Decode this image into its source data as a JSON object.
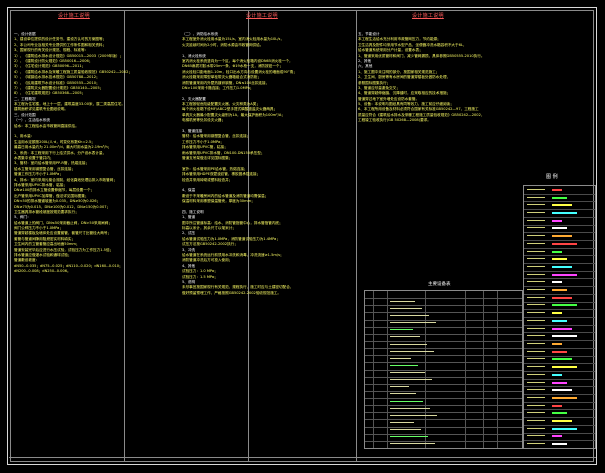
{
  "sheet": {
    "col1_title": "设计施工说明",
    "col2_title": "设计施工说明",
    "col3_title": "设计施工说明",
    "legend_title": "图 例",
    "table_title": "主要设备表"
  },
  "col1": [
    {
      "t": "一、设计依据",
      "s": "h"
    },
    {
      "t": "1、建设单位提供的设计任务书，建设方认可的方案图等；",
      "s": "y"
    },
    {
      "t": "2、本公司专业及相关专业提供的工作条件图和相关资料；",
      "s": "y"
    },
    {
      "t": "3、国家现行的有关设计规范、规程、标准等：",
      "s": "y"
    },
    {
      "t": "  1）、《建筑给水排水设计规范》GB50015—2003（2009年版）；",
      "s": "y"
    },
    {
      "t": "  2）、《建筑设计防火规范》GB50016—2006；",
      "s": "y"
    },
    {
      "t": "  3）、《住宅设计规范》GB50096—2011；",
      "s": "y"
    },
    {
      "t": "  4）、《建筑给水排水及采暖工程施工质量验收规范》GB50242—2002；",
      "s": "y"
    },
    {
      "t": "  5）、《城镇给水排水技术规范》GB50788—2012；",
      "s": "y"
    },
    {
      "t": "  6）、《民用建筑节水设计标准》GB50555—2010；",
      "s": "y"
    },
    {
      "t": "  7）、《建筑灭火器配置设计规范》GB50140—2005；",
      "s": "y"
    },
    {
      "t": "  8）、《住宅建筑规范》GB50368—2005；",
      "s": "y"
    },
    {
      "t": "二、工程概况",
      "s": "h"
    },
    {
      "t": "  本工程为住宅楼，地上十一层，建筑高度33.00米，属二类高层住宅。",
      "s": "y"
    },
    {
      "t": "  建筑面积详见建筑专业图纸说明。",
      "s": "y"
    },
    {
      "t": "三、设计范围",
      "s": "h"
    },
    {
      "t": "（一）、生活给水系统",
      "s": "h"
    },
    {
      "t": "  给水：本工程给水由市政管网直接供给。",
      "s": "y"
    },
    {
      "t": "",
      "s": "y"
    },
    {
      "t": "  1、用水量：",
      "s": "y"
    },
    {
      "t": "  生活用水定额按200L/人·d，时变化系数Kh=2.5；",
      "s": "y"
    },
    {
      "t": "  最高日用水量约为  21.00m³/d，最大时用水量为2.19m³/h；",
      "s": "y"
    },
    {
      "t": "  2、系统：本工程采用下行上给式供水，分户设水表计量，",
      "s": "y"
    },
    {
      "t": "  水表集中设置于管井内；",
      "s": "y"
    },
    {
      "t": "  3、管材：室内给水管采用PP-R管，热熔连接；",
      "s": "y"
    },
    {
      "t": "  给水立管采用钢塑复合管，丝扣连接；",
      "s": "y"
    },
    {
      "t": "  管道工作压力不小于1.0MPa；",
      "s": "y"
    },
    {
      "t": "  4、排水：室内采用污废合流制，经化粪池处理后排入市政管网；",
      "s": "y"
    },
    {
      "t": "  排水管采用UPVC排水管，粘接；",
      "s": "y"
    },
    {
      "t": "  DN≥100的排水立管设置伸缩节，每层设置一个；",
      "s": "y"
    },
    {
      "t": "  出户管采用UPVC加厚管，做法详见国标图集；",
      "s": "y"
    },
    {
      "t": "  DN<50的排水管道坡度为0.035，DN≥50为0.026；",
      "s": "y"
    },
    {
      "t": "  DN≥75为0.015，DN≥100为0.012，DN≥150为0.007；",
      "s": "y"
    },
    {
      "t": "  卫生器具排水管段坡度按规范要求执行；",
      "s": "y"
    },
    {
      "t": "5、阀门：",
      "s": "h"
    },
    {
      "t": "  给水管道上的阀门，DN≤50采用截止阀，DN>50采用闸阀；",
      "s": "y"
    },
    {
      "t": "  阀门公称压力不小于1.0MPa；",
      "s": "y"
    },
    {
      "t": "  管道穿越楼板及墙体处应设置套管，套管尺寸比管径大两号；",
      "s": "y"
    },
    {
      "t": "  套管与管道间隙用阻燃密实材料填实；",
      "s": "y"
    },
    {
      "t": "  卫生间内的立管套管应高出地面50mm；",
      "s": "y"
    },
    {
      "t": "  管道安装完毕后应进行水压试验，试验压力为工作压力1.5倍；",
      "s": "y"
    },
    {
      "t": "  排水管道应做灌水试验和通球试验；",
      "s": "y"
    },
    {
      "t": "  管道敷设坡度：",
      "s": "y"
    },
    {
      "t": "  dN50--0.035；dN75--0.025；dN110--0.020；dN160--0.010；",
      "s": "y"
    },
    {
      "t": "  dN200--0.008；dN250--0.006。",
      "s": "y"
    }
  ],
  "col2": [
    {
      "t": "（二）、消防给水系统",
      "s": "h"
    },
    {
      "t": "  本工程室外消火栓用水量为15L/s，室内消火栓用水量为10L/s，",
      "s": "y"
    },
    {
      "t": "  火灾延续时间为2小时，消防水源由市政管网供给。",
      "s": "y"
    },
    {
      "t": "",
      "s": "y"
    },
    {
      "t": "1、消火栓系统",
      "s": "h"
    },
    {
      "t": "  室内消火栓系统竖向为一个区，每个消火栓箱内设DN65消火栓一个，",
      "s": "y"
    },
    {
      "t": "  DN65麻质衬胶水带25m一条，Φ19水枪一支，消防按钮一个；",
      "s": "y"
    },
    {
      "t": "  消火栓栓口距地面1.10m，栓口出水方向与设置消火栓的墙面成90°角；",
      "s": "y"
    },
    {
      "t": "  消火栓箱采用薄型单栓带灭火器箱组合式消防柜；",
      "s": "y"
    },
    {
      "t": "  消防管道采用内外壁热镀锌钢管，DN≤100丝扣连接，",
      "s": "y"
    },
    {
      "t": "  DN>100采用卡箍连接；工作压力1.0MPa；",
      "s": "y"
    },
    {
      "t": "",
      "s": "y"
    },
    {
      "t": "2、灭火器配置",
      "s": "h"
    },
    {
      "t": "  本工程按轻危险级配置灭火器，火灾种类为A类；",
      "s": "y"
    },
    {
      "t": "  每个消火栓箱下设MF/ABC2型手提式磷酸铵盐灭火器两具；",
      "s": "y"
    },
    {
      "t": "  单具灭火器最小配置灭火级别为1A，最大保护面积为100m²/A；",
      "s": "y"
    },
    {
      "t": "  电梯机房等处另设灭火器；",
      "s": "y"
    },
    {
      "t": "",
      "s": "y"
    },
    {
      "t": "3、管道连接",
      "s": "h"
    },
    {
      "t": "  管材：给水管采用钢塑复合管，丝扣连接；",
      "s": "y"
    },
    {
      "t": "  工作压力不小于1.0MPa；",
      "s": "y"
    },
    {
      "t": "  排水管采用UPVC管，粘接；",
      "s": "y"
    },
    {
      "t": "  雨水管采用UPVC排水管，DN100-DN150承压型；",
      "s": "y"
    },
    {
      "t": "  管道支吊架做法详见国标图集；",
      "s": "y"
    },
    {
      "t": "",
      "s": "y"
    },
    {
      "t": "  室外：给水管采用PE给水管，热熔连接；",
      "s": "y"
    },
    {
      "t": "  排水管采用HDPE双壁波纹管，橡胶圈承插连接；",
      "s": "y"
    },
    {
      "t": "  检查井采用砖砌或塑料检查井；",
      "s": "y"
    },
    {
      "t": "",
      "s": "y"
    },
    {
      "t": "4、保温",
      "s": "h"
    },
    {
      "t": "  敷设于不采暖房间内的给水管道及消防管道均需保温；",
      "s": "y"
    },
    {
      "t": "  保温材料采用橡塑保温管壳，厚度为30mm；",
      "s": "y"
    },
    {
      "t": "",
      "s": "y"
    },
    {
      "t": "四、施工说明",
      "s": "h"
    },
    {
      "t": "1、管道",
      "s": "h"
    },
    {
      "t": "  图中所注管道标高：给水、消防管指管中心，排水管指管内底；",
      "s": "y"
    },
    {
      "t": "  标高以米计，其余尺寸以毫米计；",
      "s": "y"
    },
    {
      "t": "2、试压",
      "s": "h"
    },
    {
      "t": "  给水管道试验压力为1.0MPa，消防管道试验压力为1.4MPa；",
      "s": "y"
    },
    {
      "t": "  试压方法按GB50242-2002执行；",
      "s": "y"
    },
    {
      "t": "3、冲洗",
      "s": "h"
    },
    {
      "t": "  给水管道在系统运行前须用水冲洗和消毒，冲洗流速≥1.5m/s；",
      "s": "y"
    },
    {
      "t": "  消防管道冲洗后方可投入使用；",
      "s": "y"
    },
    {
      "t": "4、其他",
      "s": "h"
    },
    {
      "t": "  试验压力：1.0  MPa；",
      "s": "y"
    },
    {
      "t": "  试验压力：1.5  MPa；",
      "s": "y"
    },
    {
      "t": "5、说明",
      "s": "h"
    },
    {
      "t": "  未尽事宜按国家现行有关规范、规程执行，施工时应与土建密切配合，",
      "s": "y"
    },
    {
      "t": "  做好预留预埋工作，严格按照GB50242-2002验收规范施工。",
      "s": "y"
    }
  ],
  "col3": [
    {
      "t": "五、节能设计",
      "s": "h"
    },
    {
      "t": "  本工程生活给水充分利用市政管网压力，节约能源；",
      "s": "y"
    },
    {
      "t": "  卫生洁具及配件均采用节水型产品，坐便器冲洗水箱容积不大于6L，",
      "s": "y"
    },
    {
      "t": "  给水管道系统采用分户计量，设置水表；",
      "s": "y"
    },
    {
      "t": "  1、管道采用优质管材和阀门，减少管网漏损，具体参照GB50555-2010执行。",
      "s": "y"
    },
    {
      "t": "2、其他",
      "s": "h"
    },
    {
      "t": "六、其他",
      "s": "h"
    },
    {
      "t": "1、施工图中未注明的部分，按国家相关规范施工；",
      "s": "y"
    },
    {
      "t": "2、卫生间、厨房等有水房间的管道穿楼板处做防水处理，",
      "s": "y"
    },
    {
      "t": "  参照国标图集执行；",
      "s": "y"
    },
    {
      "t": "3、管道应尽量避免交叉；",
      "s": "y"
    },
    {
      "t": "4、管道穿越伸缩缝、沉降缝时，应采取相应的技术措施；",
      "s": "y"
    },
    {
      "t": "  管道穿过地下室外墙处应设防水套管。",
      "s": "y"
    },
    {
      "t": "5、设备：本说明与图纸具有同等效力，施工前应仔细阅读；",
      "s": "y"
    },
    {
      "t": "6、本工程所用设备及材料必须符合国家有关标准GB50242—97，工程施工",
      "s": "y"
    },
    {
      "t": "  质量应符合《建筑给水排水及采暖工程施工质量验收规范》GB50242—2002，",
      "s": "y"
    },
    {
      "t": "  工程竣工验收执行(GB 50268—2008)要求。",
      "s": "y"
    }
  ],
  "legend_rows": 34,
  "table_rows": 22
}
